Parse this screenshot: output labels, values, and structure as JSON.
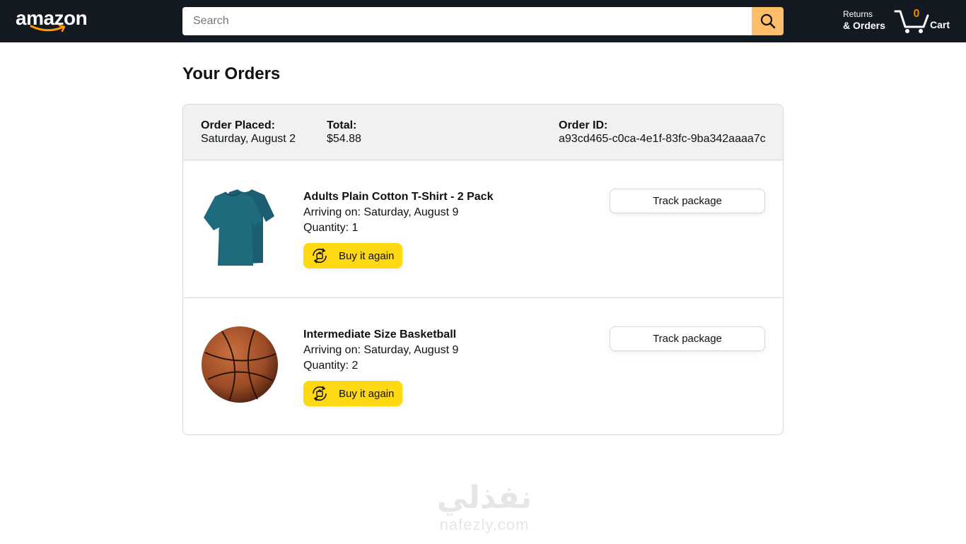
{
  "header": {
    "logo_text": "amazon",
    "search": {
      "placeholder": "Search",
      "value": "",
      "icon": "search-icon"
    },
    "returns": {
      "line1": "Returns",
      "line2": "& Orders"
    },
    "cart": {
      "count": "0",
      "label": "Cart",
      "icon": "cart-icon"
    }
  },
  "page": {
    "title": "Your Orders"
  },
  "order": {
    "placed_label": "Order Placed:",
    "placed_value": "Saturday, August 2",
    "total_label": "Total:",
    "total_value": "$54.88",
    "id_label": "Order ID:",
    "id_value": "a93cd465-c0ca-4e1f-83fc-9ba342aaaa7c",
    "items": [
      {
        "name": "Adults Plain Cotton T-Shirt - 2 Pack",
        "arriving": "Arriving on: Saturday, August 9",
        "quantity": "Quantity: 1",
        "buy_label": "Buy it again",
        "track_label": "Track package",
        "image_icon": "tshirt-image"
      },
      {
        "name": "Intermediate Size Basketball",
        "arriving": "Arriving on: Saturday, August 9",
        "quantity": "Quantity: 2",
        "buy_label": "Buy it again",
        "track_label": "Track package",
        "image_icon": "basketball-image"
      }
    ]
  },
  "watermark": {
    "arabic": "نفذلي",
    "latin": "nafezly.com"
  },
  "colors": {
    "header_bg": "#131921",
    "search_button": "#febd69",
    "cart_count": "#f08804",
    "buy_button": "#ffd814",
    "order_header_bg": "#f0f2f2",
    "border": "#d5d9d9",
    "logo_smile": "#ff9900"
  }
}
